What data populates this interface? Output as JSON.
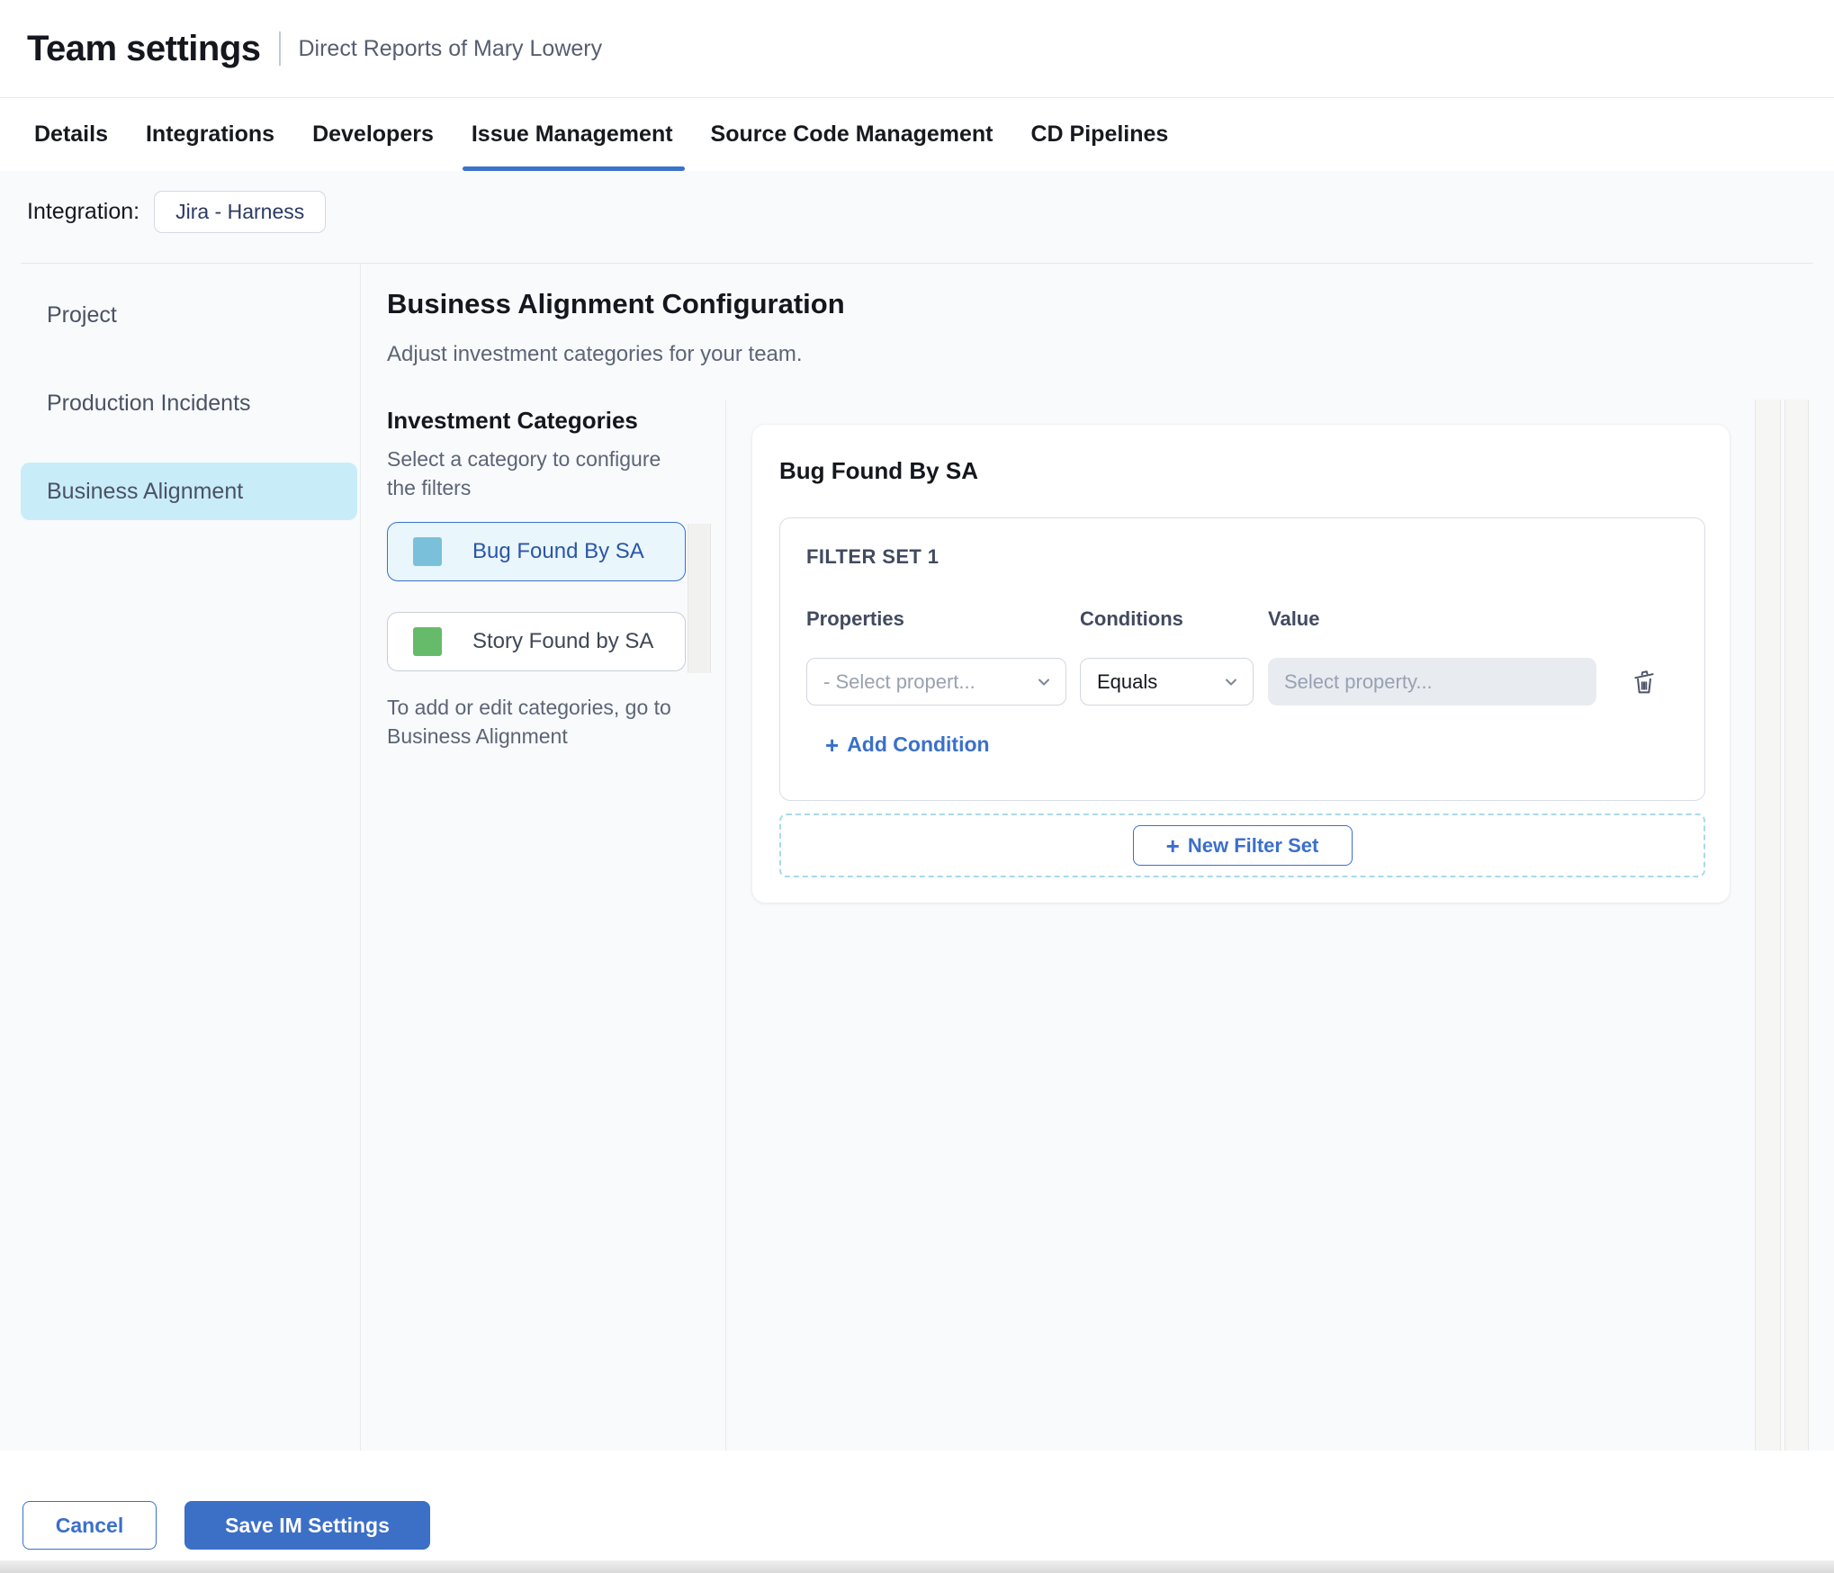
{
  "page": {
    "title": "Team settings",
    "subtitle": "Direct Reports of Mary Lowery"
  },
  "tabs": {
    "items": [
      {
        "label": "Details",
        "active": false
      },
      {
        "label": "Integrations",
        "active": false
      },
      {
        "label": "Developers",
        "active": false
      },
      {
        "label": "Issue Management",
        "active": true
      },
      {
        "label": "Source Code Management",
        "active": false
      },
      {
        "label": "CD Pipelines",
        "active": false
      }
    ]
  },
  "integration": {
    "label": "Integration:",
    "value": "Jira - Harness"
  },
  "sidebar": {
    "items": [
      {
        "label": "Project",
        "active": false
      },
      {
        "label": "Production Incidents",
        "active": false
      },
      {
        "label": "Business Alignment",
        "active": true
      }
    ]
  },
  "main": {
    "heading": "Business Alignment Configuration",
    "subheading": "Adjust investment categories for your team.",
    "categories": {
      "heading": "Investment Categories",
      "subheading": "Select a category to configure the filters",
      "items": [
        {
          "label": "Bug Found By SA",
          "swatch_color": "#7BC0DB",
          "selected": true
        },
        {
          "label": "Story Found by SA",
          "swatch_color": "#66BB6A",
          "selected": false
        }
      ],
      "footnote": "To add or edit categories, go to Business Alignment"
    },
    "detail": {
      "heading": "Bug Found By SA",
      "filter_set": {
        "title": "FILTER SET 1",
        "columns": {
          "properties": "Properties",
          "conditions": "Conditions",
          "value": "Value"
        },
        "property_select": {
          "placeholder": "- Select propert..."
        },
        "condition_select": {
          "value": "Equals"
        },
        "value_input": {
          "placeholder": "Select property..."
        },
        "add_condition_label": "Add Condition"
      },
      "new_filter_set_label": "New Filter Set"
    }
  },
  "footer": {
    "cancel_label": "Cancel",
    "save_label": "Save IM Settings"
  },
  "icons": {
    "plus": "+"
  },
  "colors": {
    "accent_blue": "#3A70CB",
    "tab_underline": "#3B72CB",
    "selected_nav_bg": "#C9ECF9",
    "selected_category_bg": "#E9F6FC",
    "selected_category_border": "#3A70CB",
    "page_bg": "#F8FAFC",
    "value_input_bg": "#E8EBF0",
    "dashed_border": "#A9D9EC",
    "save_button_bg": "#3C6FC6"
  }
}
